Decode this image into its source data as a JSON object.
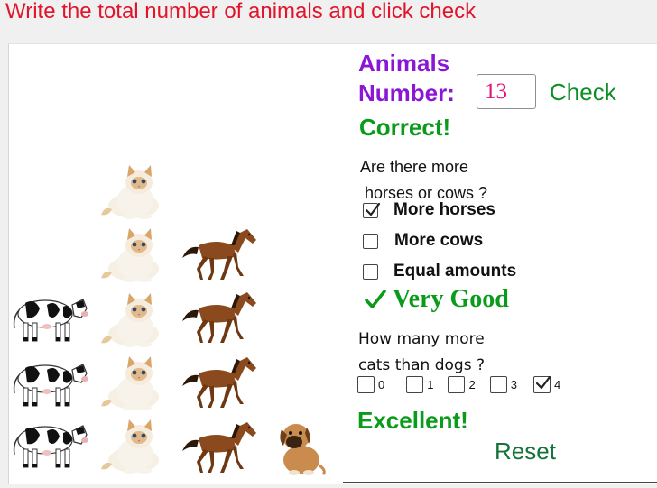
{
  "instruction": "Write the total number of animals and click check",
  "form": {
    "label_line1": "Animals",
    "label_line2": "Number:",
    "number_value": "13",
    "check_label": "Check",
    "result": "Correct!"
  },
  "question1": {
    "line1": "Are there more",
    "line2": "horses or cows ?",
    "options": [
      {
        "label": "More horses",
        "checked": true
      },
      {
        "label": "More cows",
        "checked": false
      },
      {
        "label": "Equal amounts",
        "checked": false
      }
    ],
    "feedback_icon": "check-mark-icon",
    "feedback": "Very Good"
  },
  "question2": {
    "line1": "How many more",
    "line2": "cats than dogs ?",
    "options": [
      {
        "label": "0",
        "checked": false
      },
      {
        "label": "1",
        "checked": false
      },
      {
        "label": "2",
        "checked": false
      },
      {
        "label": "3",
        "checked": false
      },
      {
        "label": "4",
        "checked": true
      }
    ],
    "feedback": "Excellent!"
  },
  "reset_label": "Reset",
  "animals": {
    "cows": 3,
    "cats": 5,
    "horses": 4,
    "dogs": 1
  },
  "colors": {
    "instruction": "#e0152b",
    "label": "#8a17d6",
    "success": "#0a9b1a",
    "input_text": "#e0157a"
  }
}
